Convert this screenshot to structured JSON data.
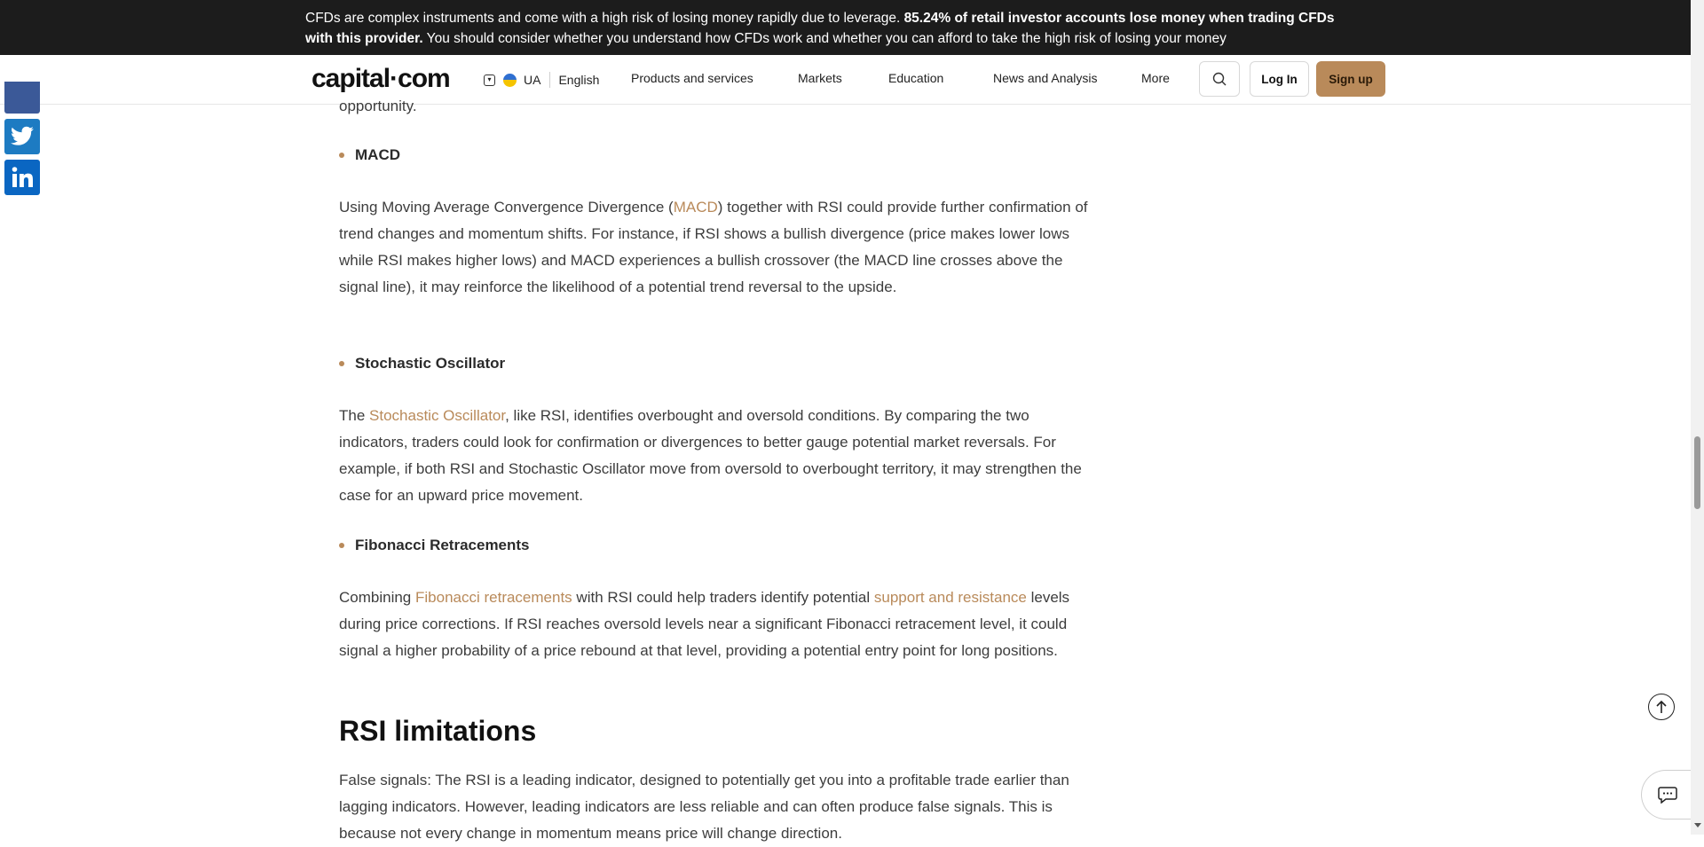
{
  "risk_banner": {
    "line1_regular": "CFDs are complex instruments and come with a high risk of losing money rapidly due to leverage. ",
    "line1_bold": "85.24% of retail investor accounts lose money when trading CFDs",
    "line2_bold": "with this provider.",
    "line2_regular": " You should consider whether you understand how CFDs work and whether you can afford to take the high risk of losing your money"
  },
  "header": {
    "logo_left": "capital",
    "logo_dot": "·",
    "logo_right": "com",
    "region_code": "UA",
    "language": "English",
    "nav": [
      "Products and services",
      "Markets",
      "Education",
      "News and Analysis",
      "More"
    ],
    "login_label": "Log In",
    "signup_label": "Sign up"
  },
  "article": {
    "intro_tail": "opportunity.",
    "sections": [
      {
        "title": "MACD",
        "p_before": "Using Moving Average Convergence Divergence (",
        "link1": "MACD",
        "p_after": ") together with RSI could provide further confirmation of trend changes and momentum shifts. For instance, if RSI shows a bullish divergence (price makes lower lows while RSI makes higher lows) and MACD experiences a bullish crossover (the MACD line crosses above the signal line), it may reinforce the likelihood of a potential trend reversal to the upside."
      },
      {
        "title": "Stochastic Oscillator",
        "p_before": "The ",
        "link1": "Stochastic Oscillator",
        "p_after": ", like RSI, identifies overbought and oversold conditions. By comparing the two indicators, traders could look for confirmation or divergences to better gauge potential market reversals. For example, if both RSI and Stochastic Oscillator move from oversold to overbought territory, it may strengthen the case for an upward price movement."
      },
      {
        "title": "Fibonacci Retracements",
        "p_before": "Combining ",
        "link1": "Fibonacci retracements",
        "p_mid": " with RSI could help traders identify potential ",
        "link2": "support and resistance",
        "p_after": " levels during price corrections. If RSI reaches oversold levels near a significant Fibonacci retracement level, it could signal a higher probability of a price rebound at that level, providing a potential entry point for long positions."
      }
    ],
    "heading": "RSI limitations",
    "limitations_p": "False signals: The RSI is a leading indicator, designed to potentially get you into a profitable trade earlier than lagging indicators. However, leading indicators are less reliable and can often produce false signals. This is because not every change in momentum means price will change direction."
  },
  "icons": {
    "search": "search-icon",
    "to_top": "arrow-up-icon",
    "chat": "chat-icon",
    "twitter": "twitter-icon",
    "linkedin": "linkedin-icon",
    "facebook": "facebook-icon"
  },
  "colors": {
    "accent": "#b98a5a",
    "banner_bg": "#1c1c1c",
    "facebook": "#3b5998",
    "twitter": "#1d7bc2",
    "linkedin": "#0a66c2"
  }
}
